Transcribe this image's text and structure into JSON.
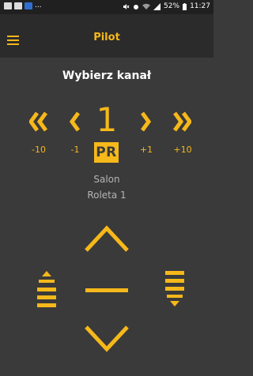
{
  "status_bar": {
    "battery": "52%",
    "time": "11:27",
    "notification_dots": "..."
  },
  "app_bar": {
    "title": "Pilot"
  },
  "channel": {
    "heading": "Wybierz kanał",
    "number": "1",
    "step_minus_10": "-10",
    "step_minus_1": "-1",
    "step_plus_1": "+1",
    "step_plus_10": "+10",
    "mode": "PR",
    "location": "Salon",
    "device": "Roleta 1"
  },
  "colors": {
    "accent": "#f6b81a",
    "background": "#3a3a3a",
    "app_bar": "#2b2b2b",
    "status_bar": "#202020"
  }
}
